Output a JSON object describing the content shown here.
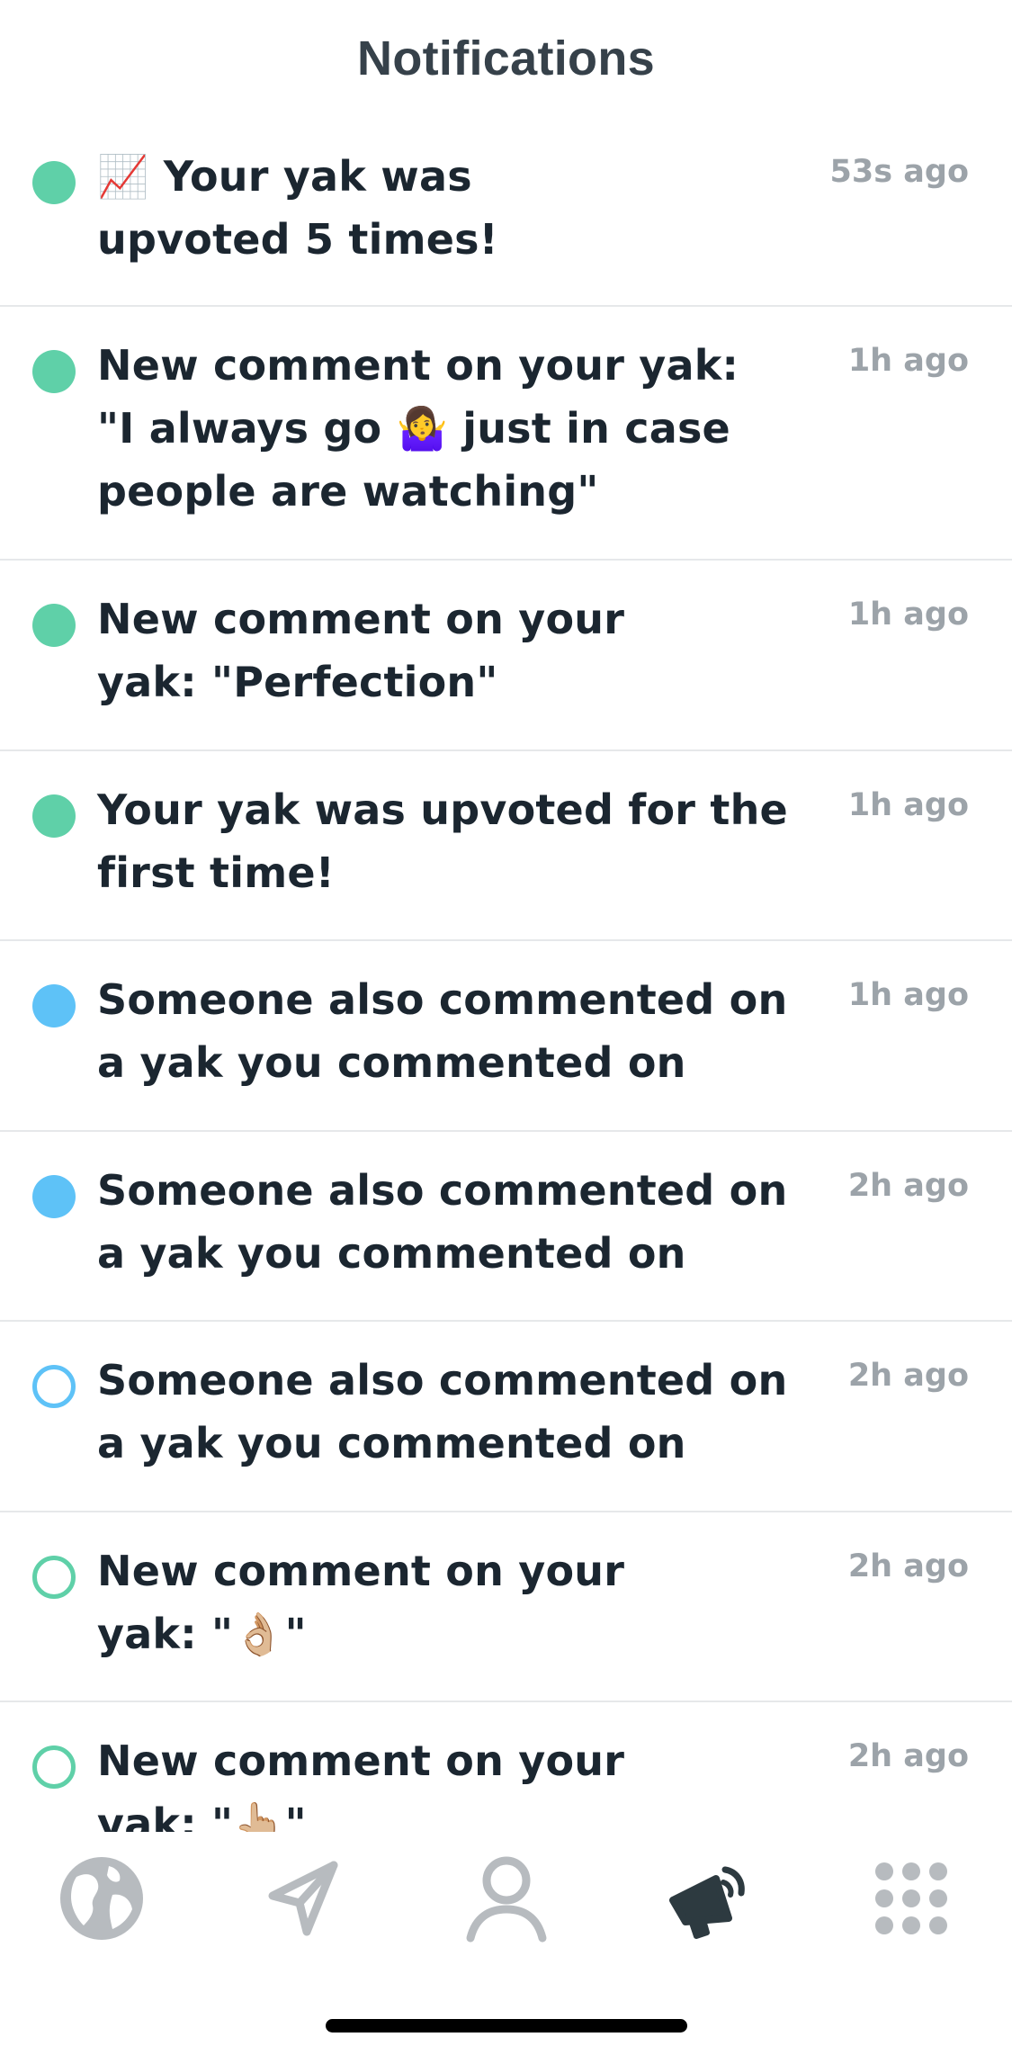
{
  "header": {
    "title": "Notifications"
  },
  "colors": {
    "green": "#5fd0a8",
    "blue": "#5ec2f7",
    "text": "#1b2630",
    "time": "#9ca3a9",
    "tab_inactive": "#b7bbbf",
    "tab_active": "#2d3a40"
  },
  "notifications": [
    {
      "indicator": "green-filled",
      "text": "📈 Your yak was upvoted 5 times!",
      "time": "53s ago"
    },
    {
      "indicator": "green-filled",
      "text": "New comment on your yak: \"I always go 🤷‍♀️ just in case people are watching\"",
      "time": "1h ago"
    },
    {
      "indicator": "green-filled",
      "text": "New comment on your yak: \"Perfection\"",
      "time": "1h ago"
    },
    {
      "indicator": "green-filled",
      "text": "Your yak was upvoted for the first time!",
      "time": "1h ago"
    },
    {
      "indicator": "blue-filled",
      "text": "Someone also commented on a yak you commented on",
      "time": "1h ago"
    },
    {
      "indicator": "blue-filled",
      "text": "Someone also commented on a yak you commented on",
      "time": "2h ago"
    },
    {
      "indicator": "blue-hollow",
      "text": "Someone also commented on a yak you commented on",
      "time": "2h ago"
    },
    {
      "indicator": "green-hollow",
      "text": "New comment on your yak: \"👌🏼\"",
      "time": "2h ago"
    },
    {
      "indicator": "green-hollow",
      "text": "New comment on your yak: \"👆🏼\"",
      "time": "2h ago"
    }
  ],
  "tabbar": {
    "tabs": [
      {
        "name": "globe-icon",
        "active": false
      },
      {
        "name": "send-icon",
        "active": false
      },
      {
        "name": "profile-icon",
        "active": false
      },
      {
        "name": "megaphone-icon",
        "active": true
      },
      {
        "name": "grid-menu-icon",
        "active": false
      }
    ]
  }
}
